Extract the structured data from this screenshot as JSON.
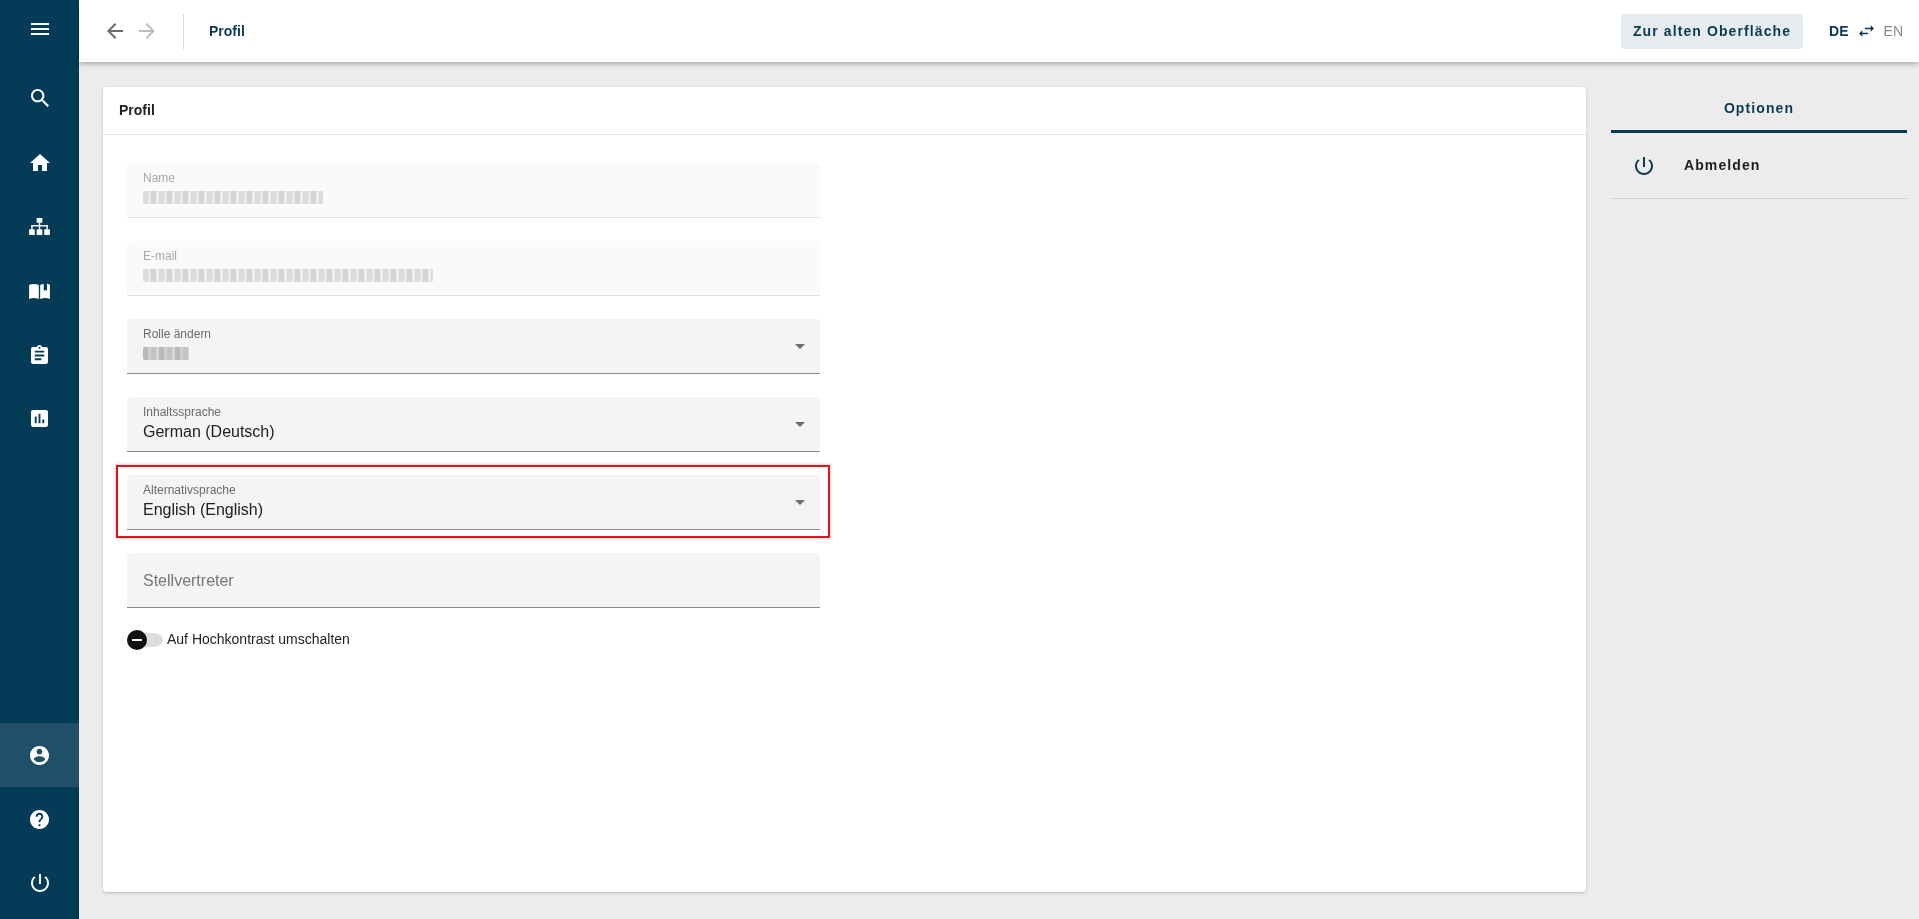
{
  "sidebar": {
    "top_items": [
      {
        "kind": "menu",
        "selected": false
      },
      {
        "kind": "search",
        "selected": false
      },
      {
        "kind": "home",
        "selected": false
      },
      {
        "kind": "sitemap",
        "selected": false
      },
      {
        "kind": "book",
        "selected": false
      },
      {
        "kind": "clipboard",
        "selected": false
      },
      {
        "kind": "chart",
        "selected": false
      }
    ],
    "bottom_items": [
      {
        "kind": "account",
        "selected": true
      },
      {
        "kind": "help",
        "selected": false
      },
      {
        "kind": "power",
        "selected": false
      }
    ]
  },
  "top_bar": {
    "nav_buttons": [
      {
        "kind": "back",
        "disabled": false
      },
      {
        "kind": "forward",
        "disabled": true
      }
    ],
    "title": "Profil",
    "legacy_button": "Zur alten Oberfläche",
    "languages": [
      {
        "label": "DE",
        "selected": true
      },
      {
        "label": "EN",
        "selected": false
      }
    ]
  },
  "profile_card": {
    "title": "Profil",
    "fields": [
      {
        "kind": "text",
        "label": "Name",
        "disabled": true,
        "redacted": true,
        "highlighted": false
      },
      {
        "kind": "text",
        "label": "E-mail",
        "disabled": true,
        "redacted": true,
        "highlighted": false
      },
      {
        "kind": "select",
        "label": "Rolle ändern",
        "disabled": false,
        "redacted": true,
        "highlighted": false
      },
      {
        "kind": "select",
        "label": "Inhaltssprache",
        "value": "German (Deutsch)",
        "disabled": false,
        "redacted": false,
        "highlighted": false
      },
      {
        "kind": "select",
        "label": "Alternativsprache",
        "value": "English (English)",
        "disabled": false,
        "redacted": false,
        "highlighted": true
      },
      {
        "kind": "text",
        "placeholder": "Stellvertreter",
        "disabled": false,
        "redacted": false,
        "highlighted": false
      }
    ],
    "toggle": {
      "label": "Auf Hochkontrast umschalten",
      "on": false
    }
  },
  "options_panel": {
    "tabs": [
      {
        "label": "Optionen",
        "selected": true
      }
    ],
    "items": [
      {
        "kind": "logout",
        "label": "Abmelden"
      }
    ]
  }
}
